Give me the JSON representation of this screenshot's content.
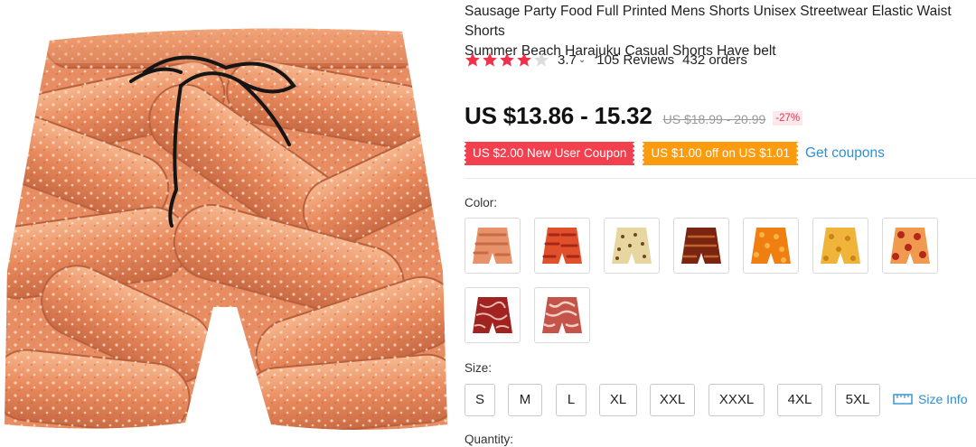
{
  "product": {
    "title": "Sausage Party Food Full Printed Mens Shorts Unisex Streetwear Elastic Waist Shorts\nSummer Beach Harajuku Casual Shorts Have belt",
    "rating": {
      "value": "3.7",
      "stars": 4,
      "max_stars": 5,
      "reviews": "105 Reviews",
      "orders": "432 orders"
    },
    "price": {
      "current": "US $13.86 - 15.32",
      "original": "US $18.99 - 20.99",
      "discount": "-27%"
    },
    "coupons": {
      "new_user": "US $2.00 New User Coupon",
      "store": "US $1.00 off on US $1.01",
      "link": "Get coupons"
    },
    "color": {
      "label": "Color:",
      "swatches": [
        {
          "name": "sausage"
        },
        {
          "name": "shrimp"
        },
        {
          "name": "cookies"
        },
        {
          "name": "bacon-dark"
        },
        {
          "name": "cheese-puffs"
        },
        {
          "name": "nuggets"
        },
        {
          "name": "pepperoni"
        },
        {
          "name": "steak"
        },
        {
          "name": "bacon"
        }
      ]
    },
    "size": {
      "label": "Size:",
      "options": [
        "S",
        "M",
        "L",
        "XL",
        "XXL",
        "XXXL",
        "4XL",
        "5XL"
      ],
      "info_link": "Size Info"
    },
    "quantity": {
      "label": "Quantity:"
    }
  },
  "colors": {
    "star_filled": "#f0314c",
    "star_empty": "#dddddd",
    "coupon_red": "#f2404f",
    "coupon_orange": "#fb9b0f",
    "link_blue": "#2d90d1"
  },
  "icons": {
    "star": "star-icon",
    "chevron": "chevron-down-icon",
    "ruler": "ruler-icon"
  }
}
